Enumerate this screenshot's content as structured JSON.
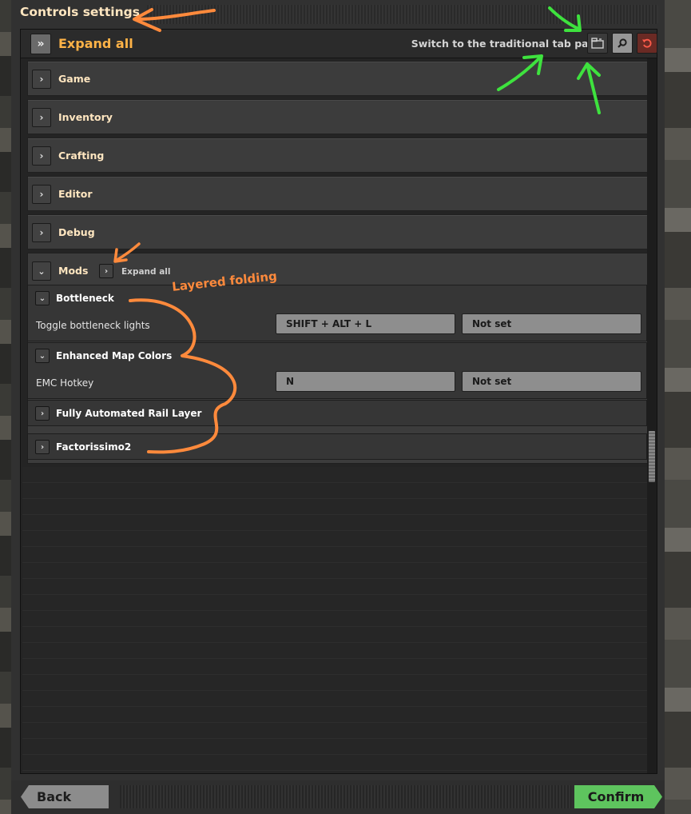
{
  "window": {
    "title": "Controls settings"
  },
  "toolbar": {
    "expand_all_icon": "»",
    "expand_all_label": "Expand all",
    "switch_label": "Switch to the traditional tab page",
    "switch_icon": "tab-page-icon",
    "search_icon": "search-icon",
    "reset_icon": "reset-icon"
  },
  "categories": [
    {
      "label": "Game",
      "expanded": false
    },
    {
      "label": "Inventory",
      "expanded": false
    },
    {
      "label": "Crafting",
      "expanded": false
    },
    {
      "label": "Editor",
      "expanded": false
    },
    {
      "label": "Debug",
      "expanded": false
    }
  ],
  "mods": {
    "label": "Mods",
    "expanded": true,
    "expand_all_label": "Expand all",
    "groups": [
      {
        "label": "Bottleneck",
        "expanded": true,
        "rows": [
          {
            "label": "Toggle bottleneck lights",
            "primary": "SHIFT + ALT + L",
            "secondary": "Not set"
          }
        ]
      },
      {
        "label": "Enhanced Map Colors",
        "expanded": true,
        "rows": [
          {
            "label": "EMC Hotkey",
            "primary": "N",
            "secondary": "Not set"
          }
        ]
      },
      {
        "label": "Fully Automated Rail Layer",
        "expanded": false
      },
      {
        "label": "Factorissimo2",
        "expanded": false
      }
    ]
  },
  "annotation": {
    "text": "Layered folding",
    "color": "#ff8a3c",
    "arrow_color_orange": "#ff8a3c",
    "arrow_color_green": "#3ee23e"
  },
  "footer": {
    "back_label": "Back",
    "confirm_label": "Confirm"
  },
  "colors": {
    "accent_orange": "#ffb347",
    "heading_cream": "#ffe6c0",
    "confirm_green": "#5ec45e",
    "reset_red": "#6a2a24"
  }
}
